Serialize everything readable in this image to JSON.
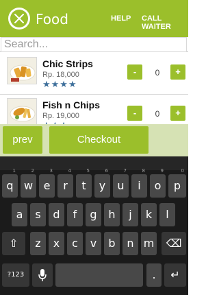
{
  "header": {
    "title": "Food",
    "help_label": "HELP",
    "call_waiter_label": "CALL WAITER"
  },
  "search": {
    "placeholder": "Search..."
  },
  "items": [
    {
      "name": "Chic Strips",
      "price": "Rp. 18,000",
      "stars": "★★★★",
      "qty": "0",
      "minus": "-",
      "plus": "+"
    },
    {
      "name": "Fish n Chips",
      "price": "Rp. 19,000",
      "stars": "★★★",
      "qty": "0",
      "minus": "-",
      "plus": "+"
    }
  ],
  "actions": {
    "prev_label": "prev",
    "checkout_label": "Checkout"
  },
  "keyboard": {
    "row1": [
      {
        "k": "q",
        "h": "1"
      },
      {
        "k": "w",
        "h": "2"
      },
      {
        "k": "e",
        "h": "3"
      },
      {
        "k": "r",
        "h": "4"
      },
      {
        "k": "t",
        "h": "5"
      },
      {
        "k": "y",
        "h": "6"
      },
      {
        "k": "u",
        "h": "7"
      },
      {
        "k": "i",
        "h": "8"
      },
      {
        "k": "o",
        "h": "9"
      },
      {
        "k": "p",
        "h": "0"
      }
    ],
    "row2": [
      "a",
      "s",
      "d",
      "f",
      "g",
      "h",
      "j",
      "k",
      "l"
    ],
    "row3": [
      "z",
      "x",
      "c",
      "v",
      "b",
      "n",
      "m"
    ],
    "shift": "⇧",
    "backspace": "⌫",
    "symbols": "?123",
    "mic": "🎙",
    "period": ".",
    "enter": "↵"
  },
  "colors": {
    "accent": "#9bbf2b",
    "action_bar": "#d6e2b4",
    "keyboard_bg": "#1b1b1b",
    "key_bg": "#484848",
    "stars": "#3e6f9b"
  }
}
